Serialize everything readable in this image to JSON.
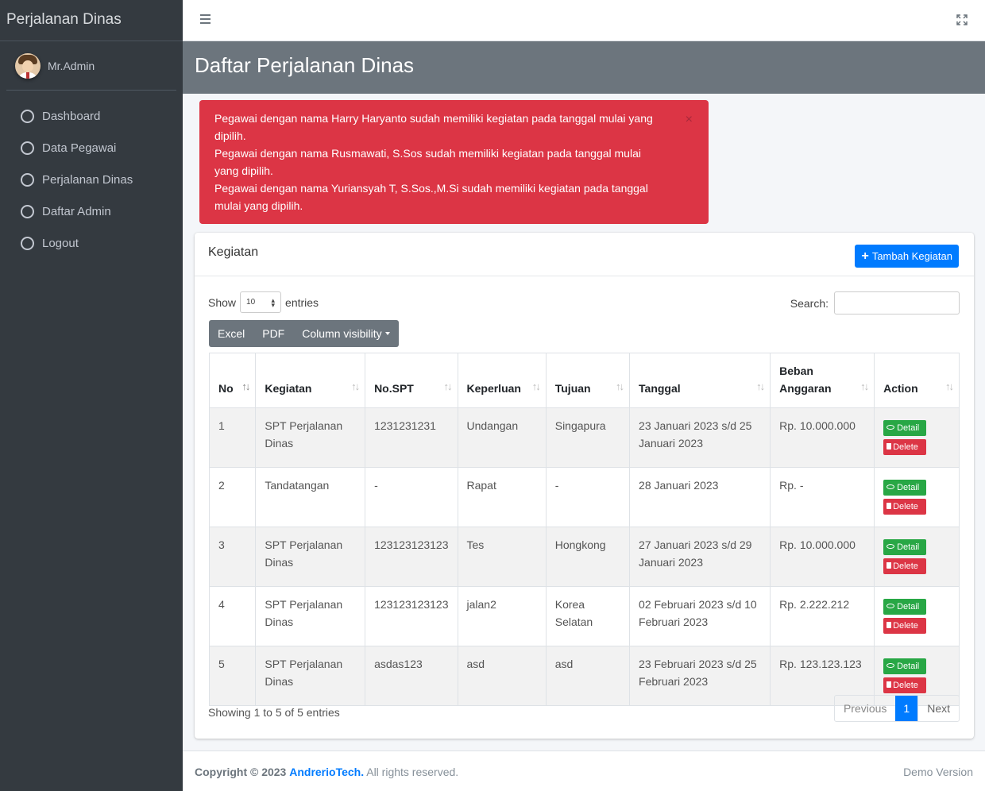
{
  "sidebar": {
    "brand": "Perjalanan Dinas",
    "user": "Mr.Admin",
    "items": [
      {
        "label": "Dashboard"
      },
      {
        "label": "Data Pegawai"
      },
      {
        "label": "Perjalanan Dinas"
      },
      {
        "label": "Daftar Admin"
      },
      {
        "label": "Logout"
      }
    ]
  },
  "header": {
    "title": "Daftar Perjalanan Dinas"
  },
  "alert": {
    "lines": [
      "Pegawai dengan nama Harry Haryanto sudah memiliki kegiatan pada tanggal mulai yang dipilih.",
      "Pegawai dengan nama Rusmawati, S.Sos sudah memiliki kegiatan pada tanggal mulai yang dipilih.",
      "Pegawai dengan nama Yuriansyah T, S.Sos.,M.Si sudah memiliki kegiatan pada tanggal mulai yang dipilih."
    ],
    "close": "×"
  },
  "card": {
    "title": "Kegiatan",
    "add_button": "Tambah Kegiatan",
    "show_label": "Show",
    "show_value": "10",
    "entries_label": "entries",
    "search_label": "Search:",
    "buttons": {
      "excel": "Excel",
      "pdf": "PDF",
      "colvis": "Column visibility"
    },
    "columns": [
      "No",
      "Kegiatan",
      "No.SPT",
      "Keperluan",
      "Tujuan",
      "Tanggal",
      "Beban Anggaran",
      "Action"
    ],
    "rows": [
      {
        "no": "1",
        "kegiatan": "SPT Perjalanan Dinas",
        "spt": "1231231231",
        "keperluan": "Undangan",
        "tujuan": "Singapura",
        "tanggal": "23 Januari 2023 s/d 25 Januari 2023",
        "anggaran": "Rp. 10.000.000"
      },
      {
        "no": "2",
        "kegiatan": "Tandatangan",
        "spt": "-",
        "keperluan": "Rapat",
        "tujuan": "-",
        "tanggal": "28 Januari 2023",
        "anggaran": "Rp. -"
      },
      {
        "no": "3",
        "kegiatan": "SPT Perjalanan Dinas",
        "spt": "123123123123",
        "keperluan": "Tes",
        "tujuan": "Hongkong",
        "tanggal": "27 Januari 2023 s/d 29 Januari 2023",
        "anggaran": "Rp. 10.000.000"
      },
      {
        "no": "4",
        "kegiatan": "SPT Perjalanan Dinas",
        "spt": "123123123123",
        "keperluan": "jalan2",
        "tujuan": "Korea Selatan",
        "tanggal": "02 Februari 2023 s/d 10 Februari 2023",
        "anggaran": "Rp. 2.222.212"
      },
      {
        "no": "5",
        "kegiatan": "SPT Perjalanan Dinas",
        "spt": "asdas123",
        "keperluan": "asd",
        "tujuan": "asd",
        "tanggal": "23 Februari 2023 s/d 25 Februari 2023",
        "anggaran": "Rp. 123.123.123"
      }
    ],
    "detail_label": "Detail",
    "delete_label": "Delete",
    "info": "Showing 1 to 5 of 5 entries",
    "pager": {
      "prev": "Previous",
      "page": "1",
      "next": "Next"
    }
  },
  "footer": {
    "copyright": "Copyright © 2023",
    "brand": "AndrerioTech.",
    "rights": "All rights reserved.",
    "version": "Demo Version"
  },
  "colors": {
    "sidebar": "#343a40",
    "header": "#6c757d",
    "alert": "#dc3545",
    "primary": "#007bff",
    "success": "#28a745"
  }
}
